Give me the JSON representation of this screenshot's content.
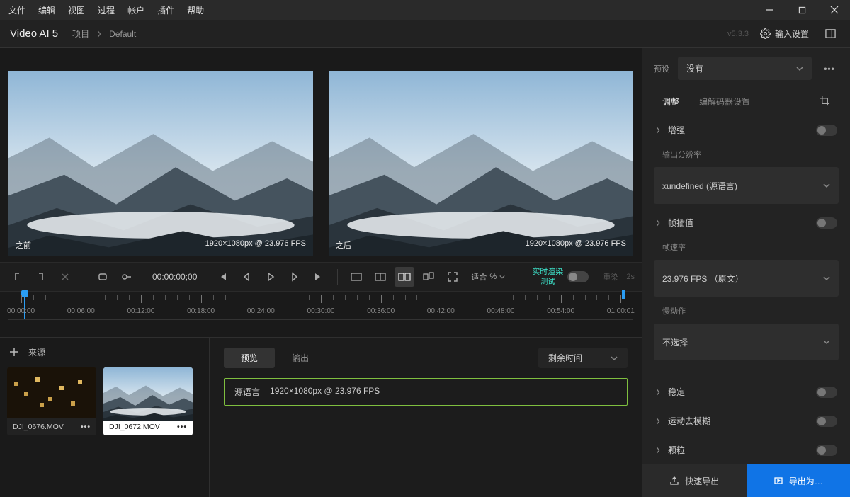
{
  "menu": {
    "items": [
      "文件",
      "编辑",
      "视图",
      "过程",
      "帐户",
      "插件",
      "帮助"
    ]
  },
  "titlebar": {
    "app": "Video AI  5",
    "crumb_label": "项目",
    "crumb_value": "Default",
    "version": "v5.3.3",
    "input_settings": "输入设置"
  },
  "preview": {
    "before_label": "之前",
    "after_label": "之后",
    "resolution": "1920×1080px @ 23.976 FPS"
  },
  "toolbar": {
    "timecode": "00:00:00;00",
    "fit_label": "适合",
    "fit_unit": "%",
    "realtime_label": "实时渲染",
    "realtime_test": "测试",
    "reload_label": "重染",
    "reload_time": "2s"
  },
  "timeline": {
    "labels": [
      "00:00:00",
      "00:06:00",
      "00:12:00",
      "00:18:00",
      "00:24:00",
      "00:30:00",
      "00:36:00",
      "00:42:00",
      "00:48:00",
      "00:54:00",
      "01:00:01"
    ]
  },
  "sources": {
    "header": "来源",
    "items": [
      {
        "name": "DJI_0676.MOV",
        "selected": false
      },
      {
        "name": "DJI_0672.MOV",
        "selected": true
      }
    ]
  },
  "queue": {
    "tabs": [
      "预览",
      "输出"
    ],
    "dropdown": "剩余时间",
    "item_label": "源语言",
    "item_res": "1920×1080px @ 23.976 FPS"
  },
  "right": {
    "preset_label": "预设",
    "preset_value": "没有",
    "tabs": [
      "调整",
      "编解码器设置"
    ],
    "enhance": "增强",
    "out_res_label": "输出分辨率",
    "out_res_value": "xundefined (源语言)",
    "frame_interp": "帧插值",
    "fps_label": "帧速率",
    "fps_value": "23.976 FPS （原文）",
    "slowmo_label": "慢动作",
    "slowmo_value": "不选择",
    "stabilize": "稳定",
    "deblur": "运动去模糊",
    "grain": "颗粒",
    "quick_export": "快速导出",
    "export_as": "导出为…"
  }
}
